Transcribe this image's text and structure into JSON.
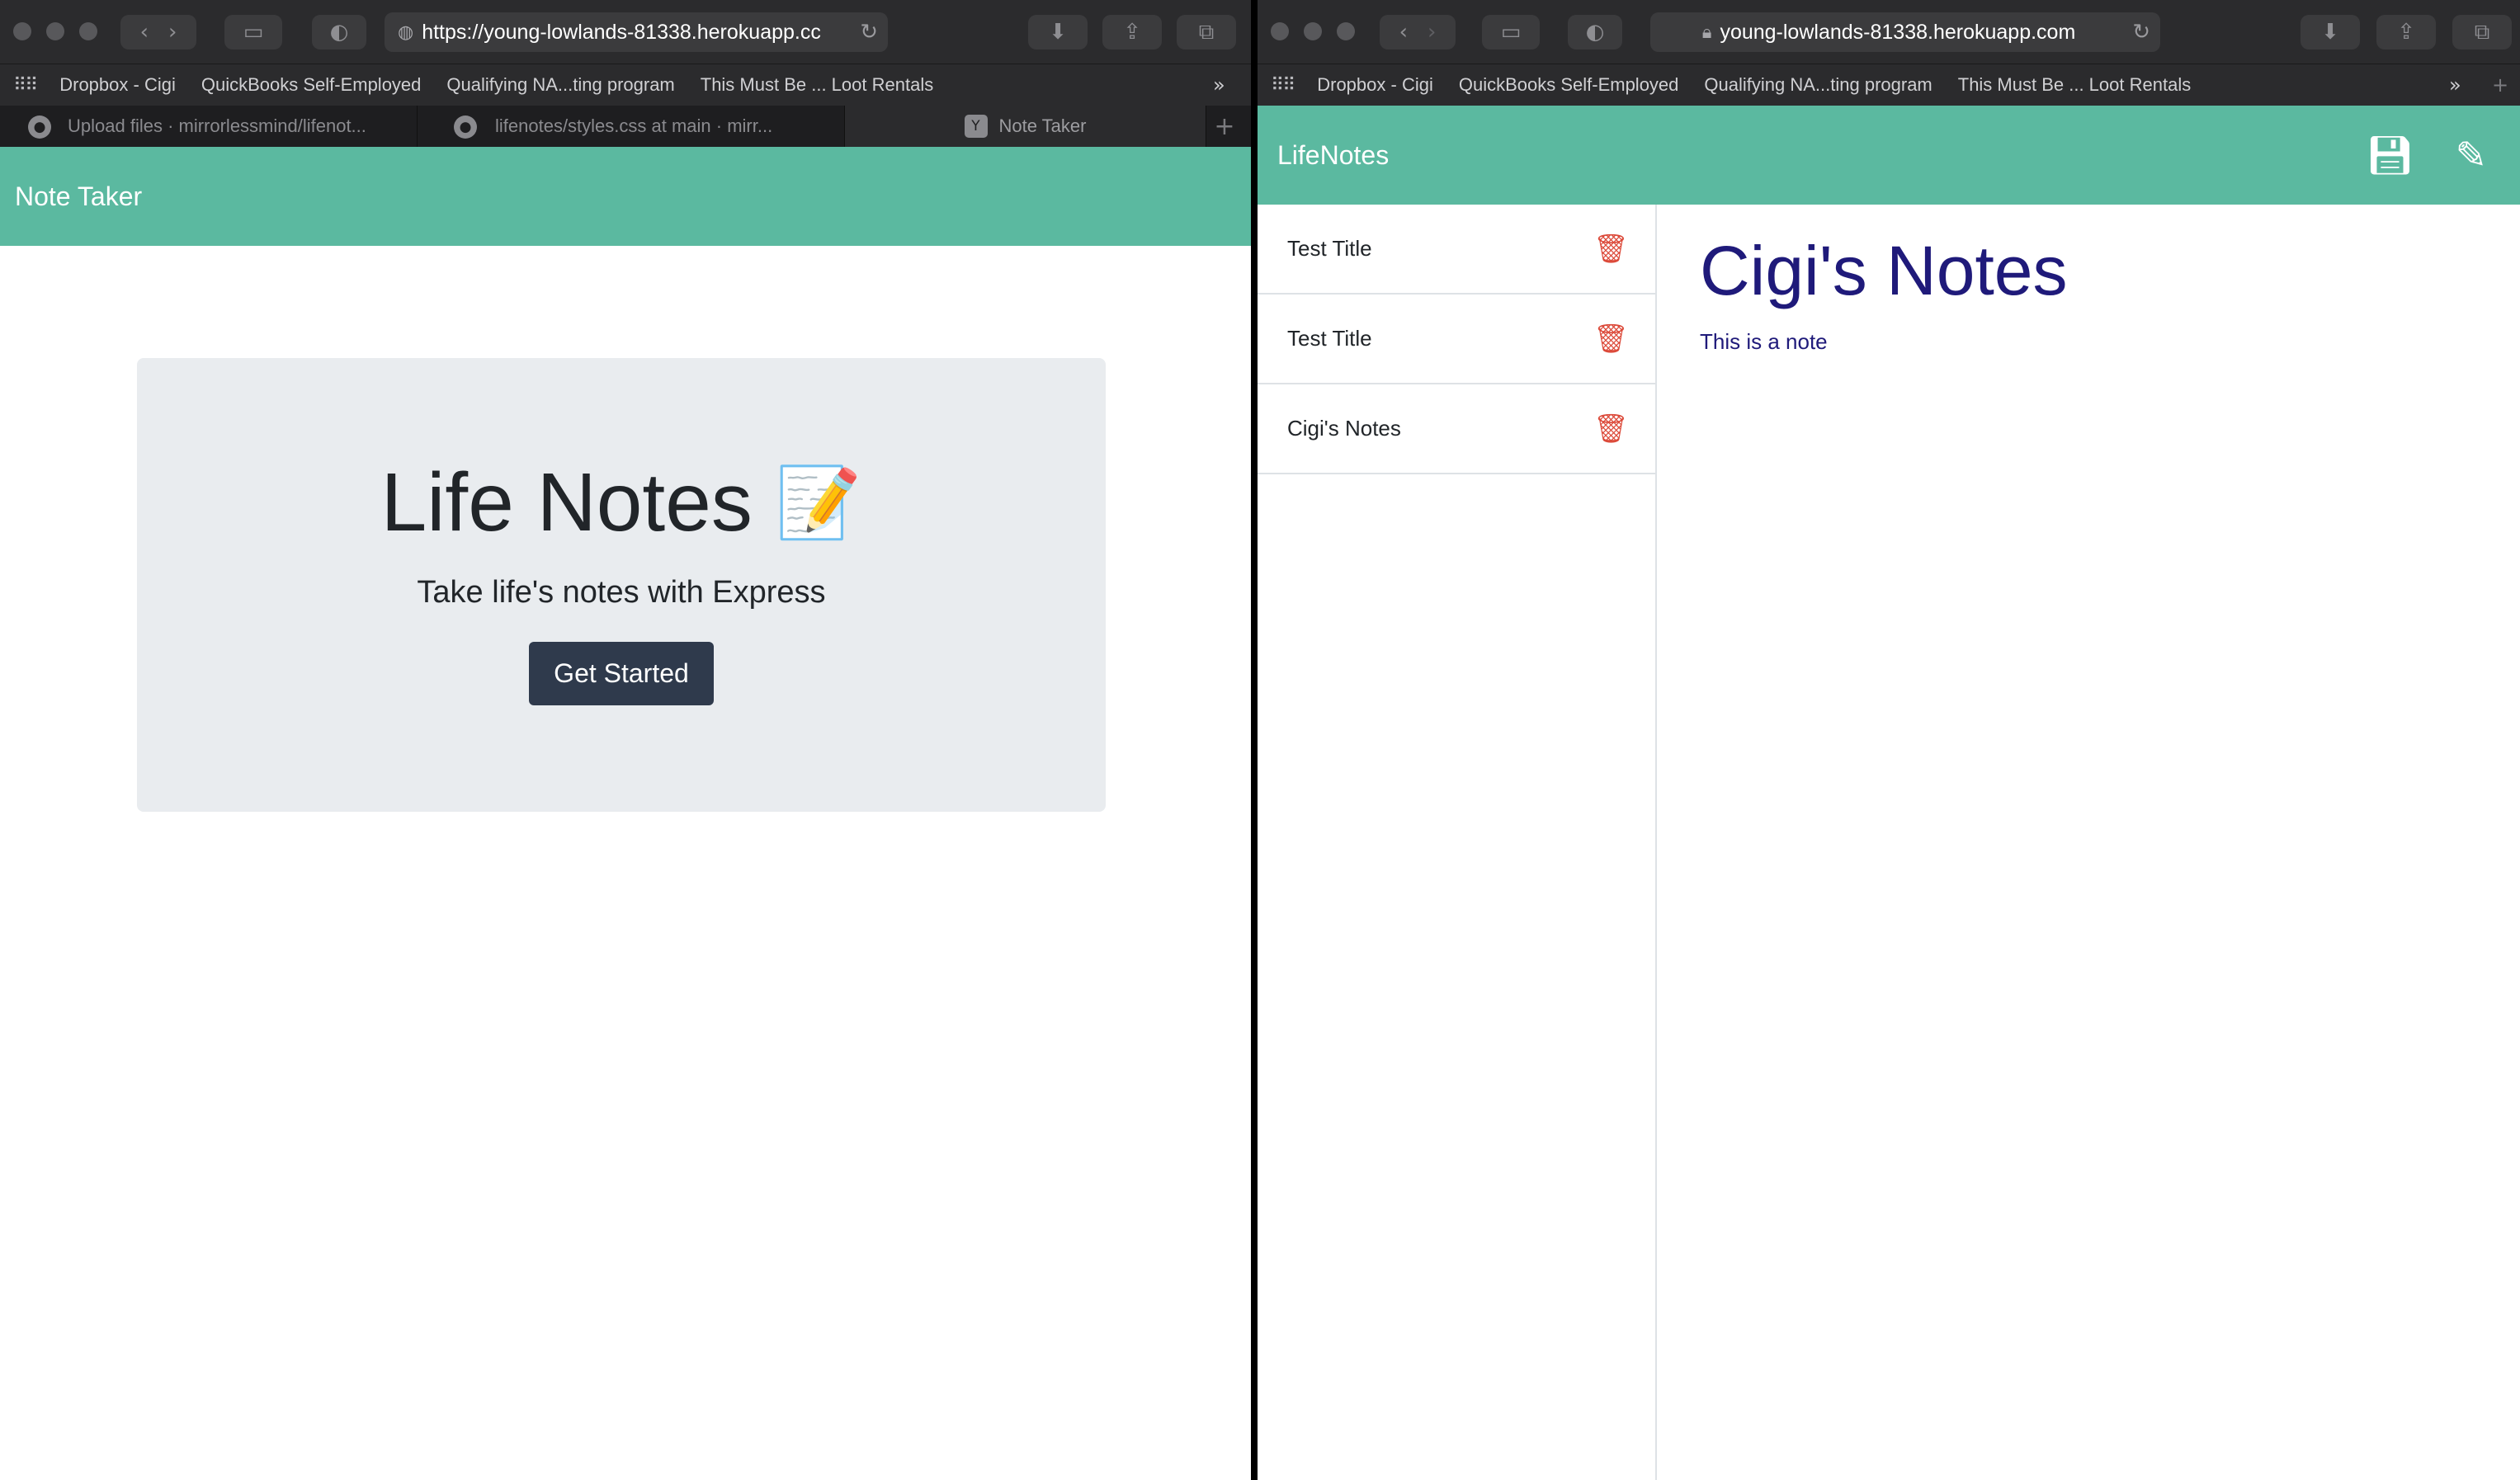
{
  "left_window": {
    "toolbar": {
      "url": "https://young-lowlands-81338.herokuapp.cc"
    },
    "bookmarks": [
      "Dropbox - Cigi",
      "QuickBooks Self-Employed",
      "Qualifying NA...ting program",
      "This Must Be ... Loot Rentals"
    ],
    "tabs": [
      {
        "label": "Upload files · mirrorlessmind/lifenot..."
      },
      {
        "label": "lifenotes/styles.css at main · mirr..."
      },
      {
        "label": "Note Taker"
      }
    ],
    "app": {
      "navbar_brand": "Note Taker",
      "hero_title": "Life Notes",
      "hero_emoji": "📝",
      "hero_subtitle": "Take life's notes with Express",
      "cta_label": "Get Started"
    }
  },
  "right_window": {
    "toolbar": {
      "url": "young-lowlands-81338.herokuapp.com"
    },
    "bookmarks": [
      "Dropbox - Cigi",
      "QuickBooks Self-Employed",
      "Qualifying NA...ting program",
      "This Must Be ... Loot Rentals"
    ],
    "app": {
      "navbar_brand": "LifeNotes",
      "notes": [
        {
          "title": "Test Title"
        },
        {
          "title": "Test Title"
        },
        {
          "title": "Cigi's Notes"
        }
      ],
      "active_note": {
        "title": "Cigi's Notes",
        "text": "This is a note"
      }
    }
  },
  "colors": {
    "navbar": "#5bb9a0",
    "jumbotron": "#e9ecef",
    "button": "#2f3a4c",
    "trash": "#dc4a3a",
    "note_text": "#1f1a7a"
  },
  "icons": [
    "back-icon",
    "forward-icon",
    "sidebar-icon",
    "shield-icon",
    "reload-icon",
    "download-icon",
    "share-icon",
    "tabs-icon",
    "save-icon",
    "pencil-icon",
    "trash-icon",
    "memo-icon"
  ]
}
